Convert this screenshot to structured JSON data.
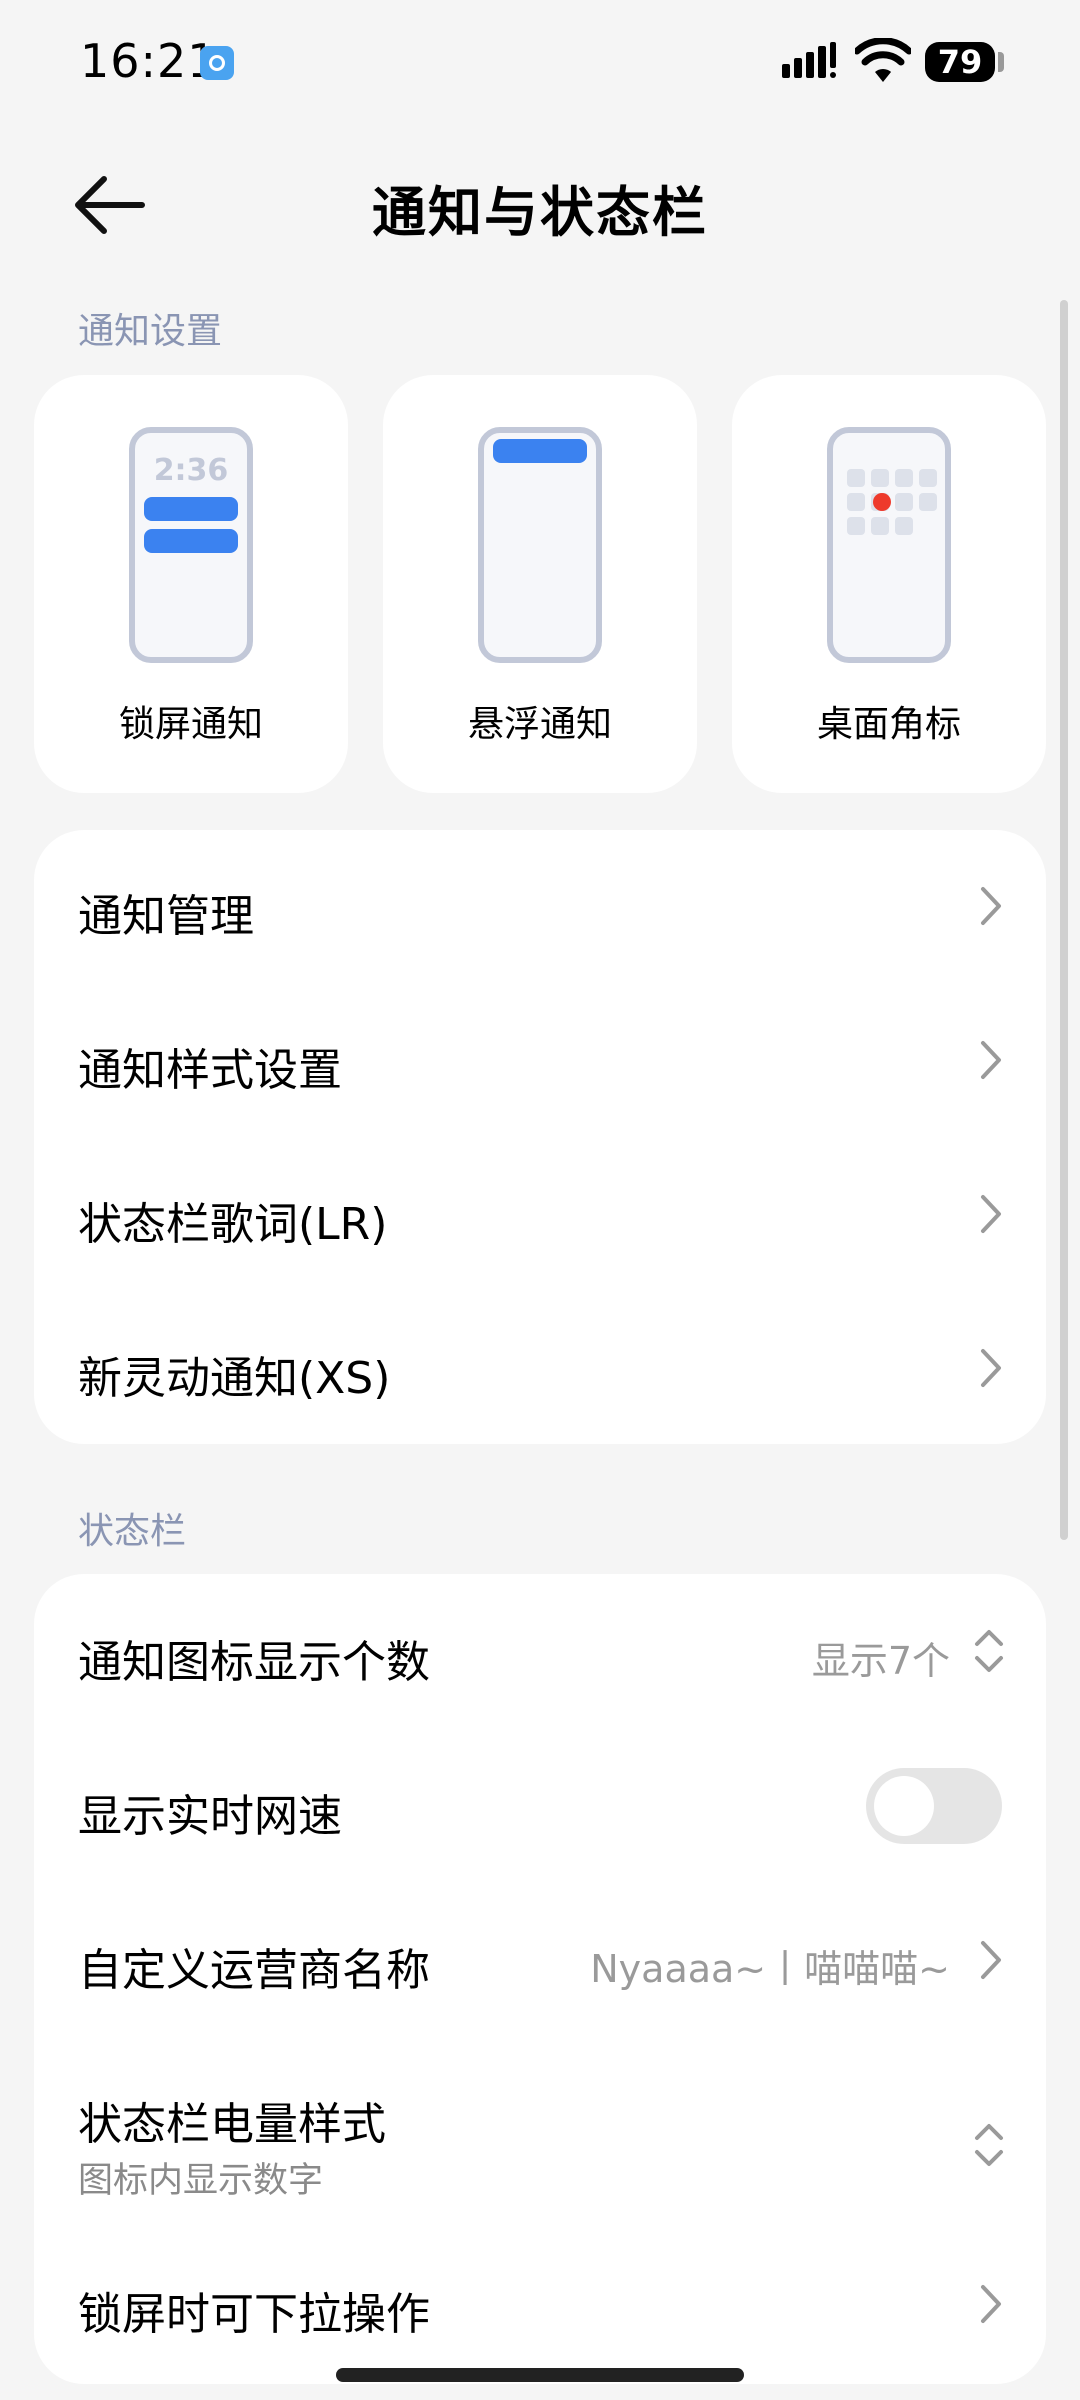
{
  "status_bar": {
    "time": "16:21",
    "battery": "79",
    "icons": [
      "app-notification-icon",
      "signal-icon",
      "wifi-icon",
      "battery-icon"
    ]
  },
  "header": {
    "title": "通知与状态栏",
    "back_icon": "back-arrow-icon"
  },
  "notification_settings": {
    "section_label": "通知设置",
    "tiles": [
      {
        "label": "锁屏通知",
        "preview_time": "2:36",
        "icon": "lockscreen-notification-icon"
      },
      {
        "label": "悬浮通知",
        "icon": "floating-notification-icon"
      },
      {
        "label": "桌面角标",
        "icon": "desktop-badge-icon"
      }
    ],
    "items": [
      {
        "label": "通知管理"
      },
      {
        "label": "通知样式设置"
      },
      {
        "label": "状态栏歌词(LR)"
      },
      {
        "label": "新灵动通知(XS)"
      }
    ]
  },
  "status_bar_settings": {
    "section_label": "状态栏",
    "items": [
      {
        "label": "通知图标显示个数",
        "value": "显示7个",
        "control": "selector"
      },
      {
        "label": "显示实时网速",
        "control": "toggle",
        "enabled": false
      },
      {
        "label": "自定义运营商名称",
        "value": "Nyaaaa~丨喵喵喵~",
        "control": "chevron"
      },
      {
        "label": "状态栏电量样式",
        "sub": "图标内显示数字",
        "control": "selector"
      },
      {
        "label": "锁屏时可下拉操作",
        "control": "chevron"
      }
    ]
  },
  "colors": {
    "accent": "#3b82f0",
    "badge_red": "#ee3a2c",
    "section_label": "#8a95b3",
    "background": "#f5f5f5"
  }
}
